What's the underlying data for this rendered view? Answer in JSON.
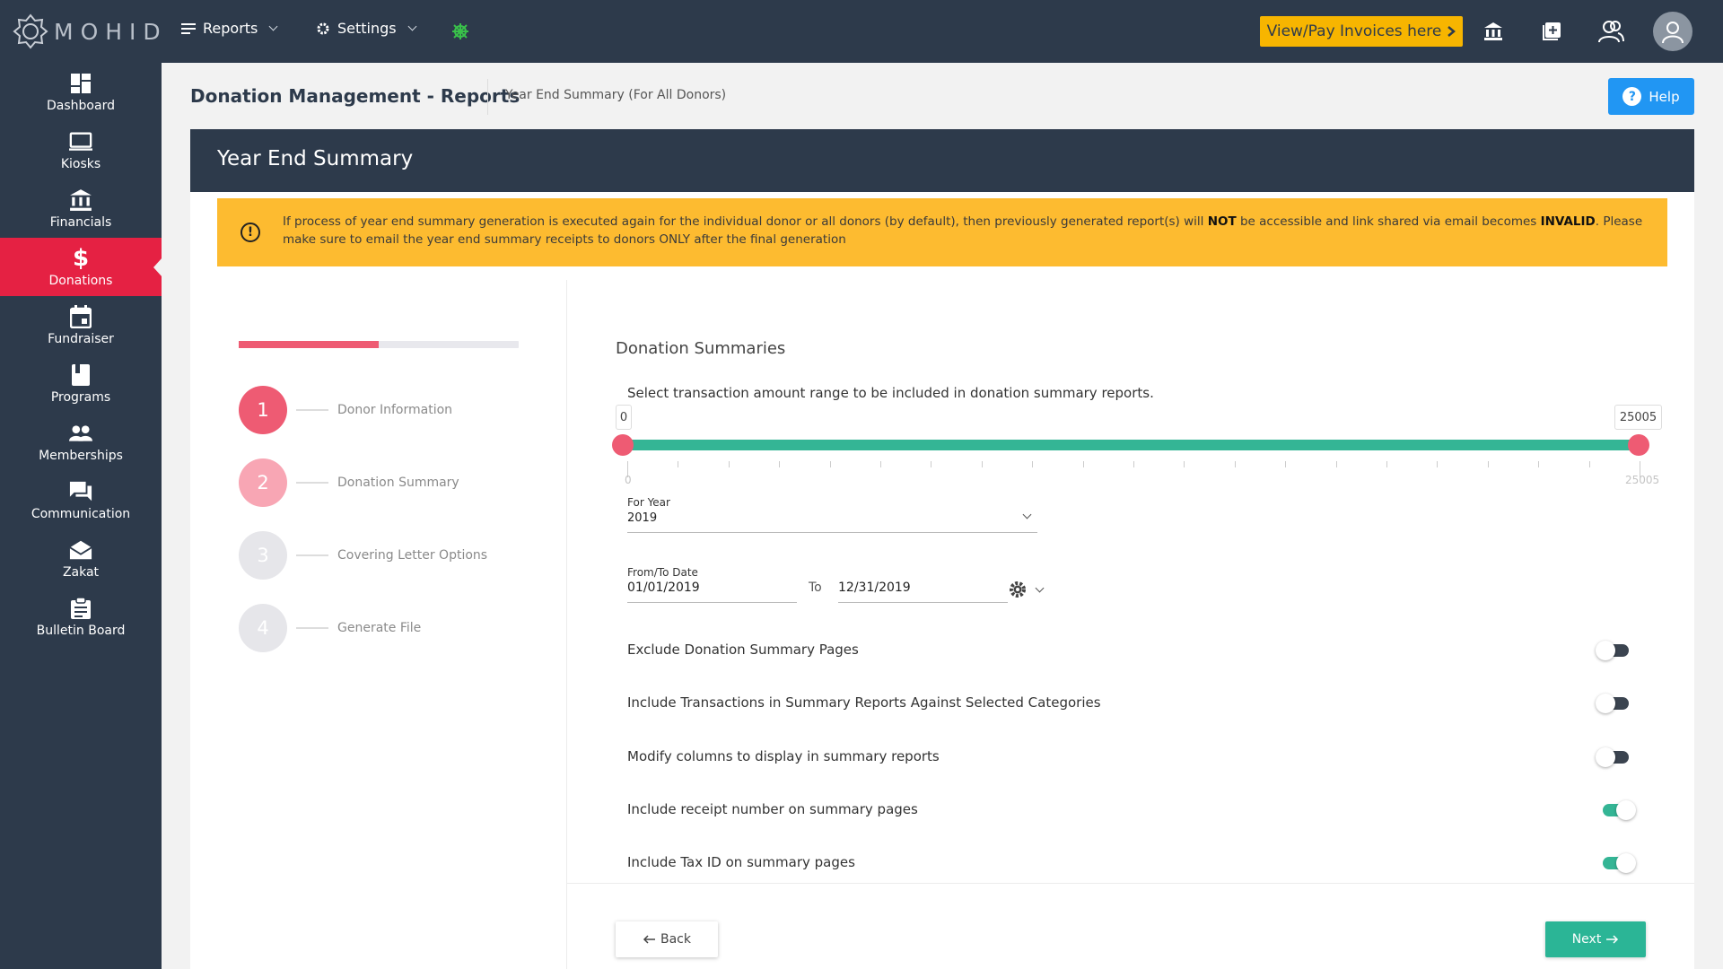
{
  "app": {
    "logo_text": "MOHID"
  },
  "topnav": {
    "reports_label": "Reports",
    "settings_label": "Settings",
    "invoice_label": "View/Pay Invoices here"
  },
  "sidebar": {
    "items": [
      {
        "label": "Dashboard",
        "icon": "dashboard-icon"
      },
      {
        "label": "Kiosks",
        "icon": "kiosk-icon"
      },
      {
        "label": "Financials",
        "icon": "bank-icon"
      },
      {
        "label": "Donations",
        "icon": "dollar-icon",
        "active": true
      },
      {
        "label": "Fundraiser",
        "icon": "calendar-icon"
      },
      {
        "label": "Programs",
        "icon": "book-icon"
      },
      {
        "label": "Memberships",
        "icon": "people-icon"
      },
      {
        "label": "Communication",
        "icon": "chat-icon"
      },
      {
        "label": "Zakat",
        "icon": "envelope-icon"
      },
      {
        "label": "Bulletin Board",
        "icon": "clipboard-icon"
      }
    ]
  },
  "header": {
    "title": "Donation Management - Reports",
    "breadcrumb": "Year End Summary (For All Donors)",
    "help_label": "Help"
  },
  "card": {
    "title": "Year End Summary",
    "alert": {
      "part1": "If process of year end summary generation is executed again for the individual donor or all donors (by default), then previously generated report(s) will ",
      "bold1": "NOT",
      "part2": " be accessible and link shared via email becomes ",
      "bold2": "INVALID",
      "part3": ". Please make sure to email the year end summary receipts to donors ONLY after the final generation"
    }
  },
  "stepper": {
    "progress": 0.5,
    "steps": [
      {
        "number": "1",
        "label": "Donor Information",
        "state": "done"
      },
      {
        "number": "2",
        "label": "Donation Summary",
        "state": "current"
      },
      {
        "number": "3",
        "label": "Covering Letter Options",
        "state": "todo"
      },
      {
        "number": "4",
        "label": "Generate File",
        "state": "todo"
      }
    ]
  },
  "form": {
    "section_title": "Donation Summaries",
    "range_prompt": "Select transaction amount range to be included in donation summary reports.",
    "range_min": "0",
    "range_max": "25005",
    "range_low_value": 0,
    "range_high_value": 25005,
    "year_label": "For Year",
    "year_value": "2019",
    "date_label": "From/To Date",
    "from_date": "01/01/2019",
    "to_label": "To",
    "to_date": "12/31/2019",
    "toggles": [
      {
        "label": "Exclude Donation Summary Pages",
        "on": false
      },
      {
        "label": "Include Transactions in Summary Reports Against Selected Categories",
        "on": false
      },
      {
        "label": "Modify columns to display in summary reports",
        "on": false
      },
      {
        "label": "Include receipt number on summary pages",
        "on": true
      },
      {
        "label": "Include Tax ID on summary pages",
        "on": true
      }
    ],
    "back_label": "Back",
    "next_label": "Next"
  },
  "colors": {
    "navy": "#2d3a4b",
    "accent_red": "#e52143",
    "step_pink": "#ee5b73",
    "teal": "#34b595",
    "alert_yellow": "#fdbb30",
    "help_blue": "#2196f3"
  }
}
